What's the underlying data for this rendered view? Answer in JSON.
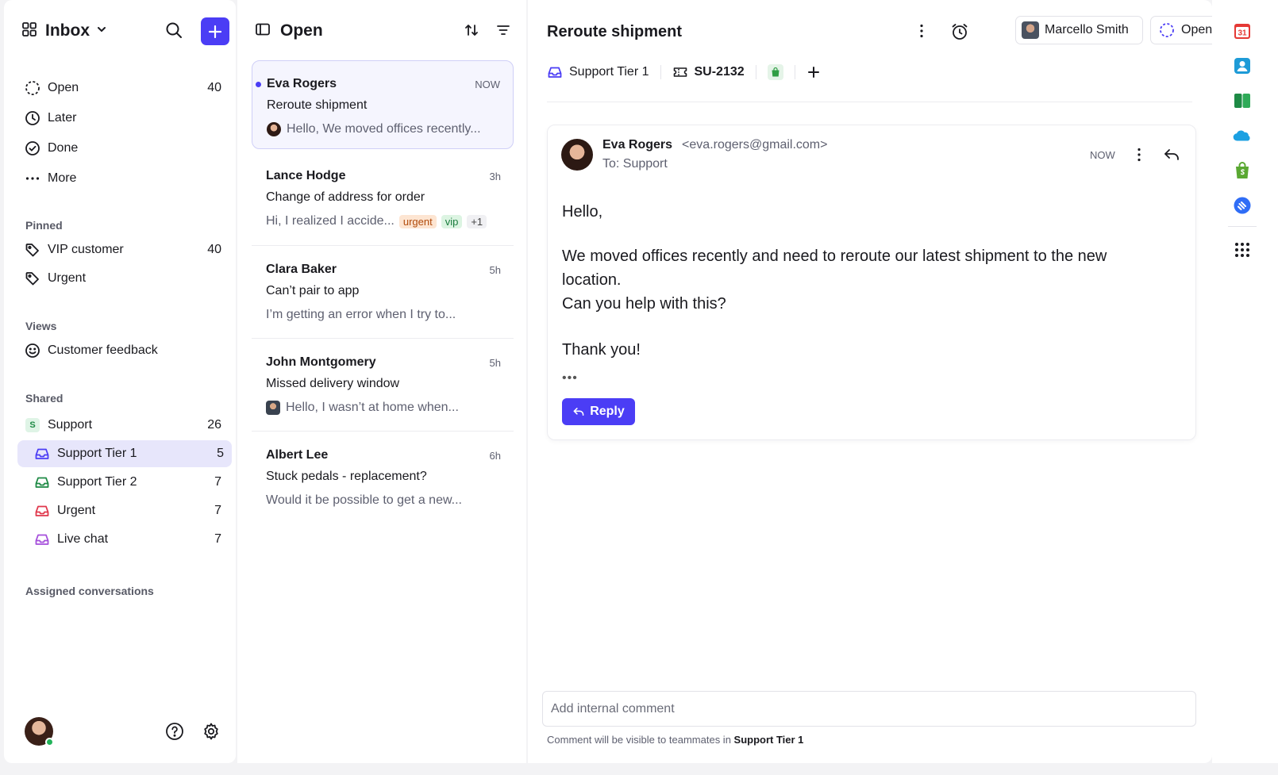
{
  "sidebar": {
    "title": "Inbox",
    "items": [
      {
        "label": "Open",
        "count": "40"
      },
      {
        "label": "Later",
        "count": ""
      },
      {
        "label": "Done",
        "count": ""
      },
      {
        "label": "More",
        "count": ""
      }
    ],
    "pinned_label": "Pinned",
    "pinned": [
      {
        "label": "VIP customer",
        "count": "40"
      },
      {
        "label": "Urgent",
        "count": ""
      }
    ],
    "views_label": "Views",
    "views": [
      {
        "label": "Customer feedback"
      }
    ],
    "shared_label": "Shared",
    "shared": [
      {
        "label": "Support",
        "count": "26",
        "badge": "S"
      },
      {
        "label": "Support Tier 1",
        "count": "5",
        "color": "#4b3df5"
      },
      {
        "label": "Support Tier 2",
        "count": "7",
        "color": "#1e8a45"
      },
      {
        "label": "Urgent",
        "count": "7",
        "color": "#e0384c"
      },
      {
        "label": "Live chat",
        "count": "7",
        "color": "#a54fdb"
      }
    ],
    "assigned_label": "Assigned conversations"
  },
  "list": {
    "title": "Open",
    "conversations": [
      {
        "name": "Eva Rogers",
        "time": "NOW",
        "subject": "Reroute shipment",
        "preview": "Hello, We moved offices recently..."
      },
      {
        "name": "Lance Hodge",
        "time": "3h",
        "subject": "Change of address for order",
        "preview": "Hi, I realized I accide...",
        "tags": [
          "urgent",
          "vip",
          "+1"
        ]
      },
      {
        "name": "Clara Baker",
        "time": "5h",
        "subject": "Can’t pair to app",
        "preview": "I’m getting an error when I try to..."
      },
      {
        "name": "John Montgomery",
        "time": "5h",
        "subject": "Missed delivery window",
        "preview": "Hello, I wasn’t at home when..."
      },
      {
        "name": "Albert Lee",
        "time": "6h",
        "subject": "Stuck pedals - replacement?",
        "preview": "Would it be possible to get a new..."
      }
    ]
  },
  "main": {
    "title": "Reroute shipment",
    "assignee": "Marcello Smith",
    "status": "Open",
    "inbox": "Support Tier 1",
    "ticket": "SU-2132",
    "message": {
      "from_name": "Eva Rogers",
      "from_email": "<eva.rogers@gmail.com>",
      "to": "To: Support",
      "time": "NOW",
      "greeting": "Hello,",
      "line1": "We moved offices recently and need to reroute our latest shipment to the new location.",
      "line2": "Can you help with this?",
      "closing": "Thank you!",
      "ellipsis": "•••"
    },
    "reply_label": "Reply",
    "comment_placeholder": "Add internal comment",
    "comment_hint": "Comment will be visible to teammates in ",
    "comment_hint_team": "Support Tier 1"
  },
  "rail": {
    "calendar_day": "31"
  },
  "colors": {
    "accent": "#4b3df5",
    "active_bg": "#e7e6fb"
  }
}
